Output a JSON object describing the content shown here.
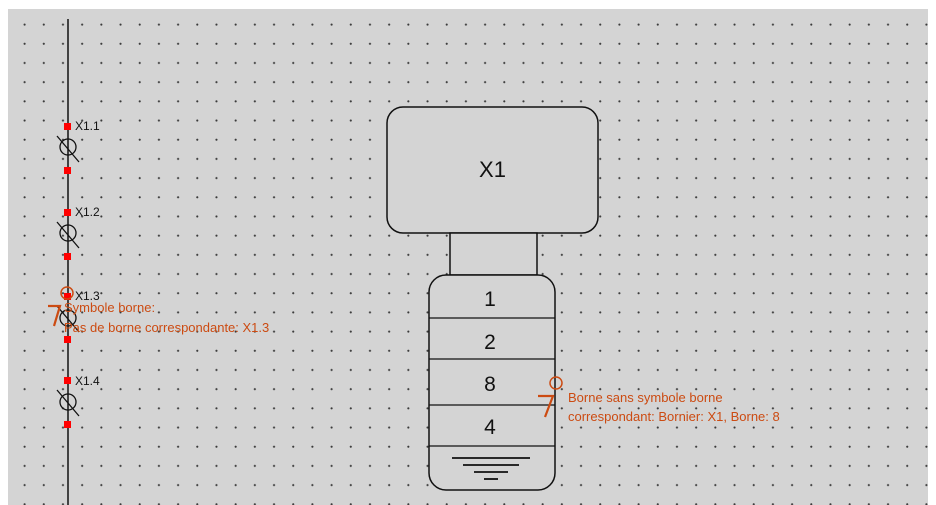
{
  "terminals": [
    {
      "label": "X1.1"
    },
    {
      "label": "X1.2"
    },
    {
      "label": "X1.3"
    },
    {
      "label": "X1.4"
    }
  ],
  "warning_left": {
    "line1": "Symbole borne:",
    "line2": "Pas de borne correspondante: X1.3"
  },
  "terminal_block": {
    "title": "X1",
    "rows": [
      "1",
      "2",
      "8",
      "4"
    ]
  },
  "warning_right": {
    "line1": "Borne sans symbole borne",
    "line2": "correspondant: Bornier: X1, Borne: 8"
  },
  "colors": {
    "background": "#d4d4d4",
    "grid_dot": "#3a3a3a",
    "connector_red": "#ff0000",
    "warning_orange": "#cc4b12"
  }
}
